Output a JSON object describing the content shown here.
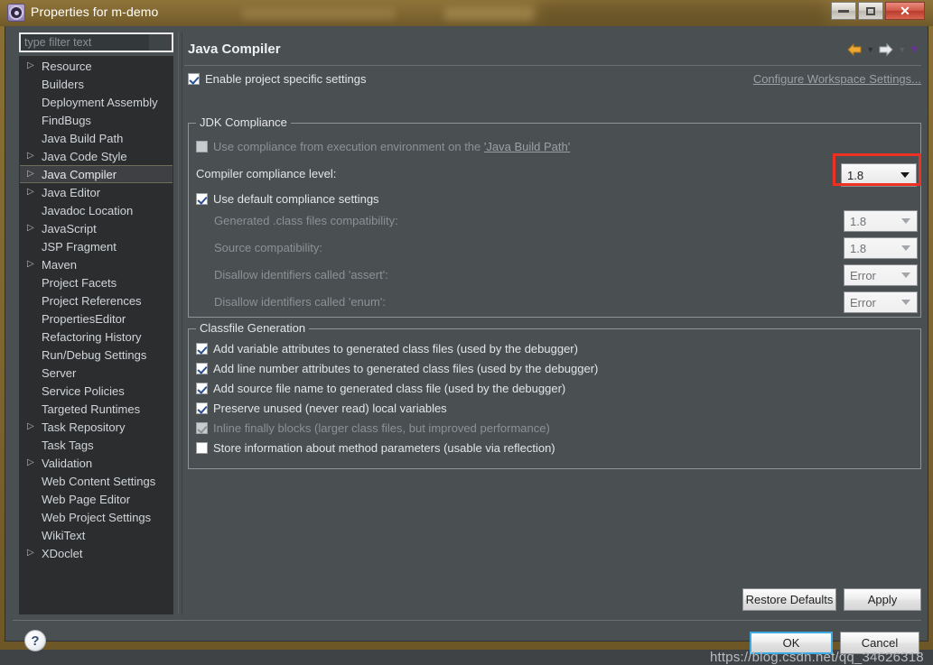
{
  "window": {
    "title": "Properties for m-demo",
    "icon": "gear-icon",
    "buttons": {
      "minimize": "minimize-icon",
      "maximize": "restore-icon",
      "close": "✕"
    }
  },
  "sidebar": {
    "filter": {
      "placeholder": "type filter text",
      "value": ""
    },
    "items": [
      {
        "label": "Resource",
        "expandable": true,
        "selected": false
      },
      {
        "label": "Builders",
        "expandable": false,
        "selected": false
      },
      {
        "label": "Deployment Assembly",
        "expandable": false,
        "selected": false
      },
      {
        "label": "FindBugs",
        "expandable": false,
        "selected": false
      },
      {
        "label": "Java Build Path",
        "expandable": false,
        "selected": false
      },
      {
        "label": "Java Code Style",
        "expandable": true,
        "selected": false
      },
      {
        "label": "Java Compiler",
        "expandable": true,
        "selected": true
      },
      {
        "label": "Java Editor",
        "expandable": true,
        "selected": false
      },
      {
        "label": "Javadoc Location",
        "expandable": false,
        "selected": false
      },
      {
        "label": "JavaScript",
        "expandable": true,
        "selected": false
      },
      {
        "label": "JSP Fragment",
        "expandable": false,
        "selected": false
      },
      {
        "label": "Maven",
        "expandable": true,
        "selected": false
      },
      {
        "label": "Project Facets",
        "expandable": false,
        "selected": false
      },
      {
        "label": "Project References",
        "expandable": false,
        "selected": false
      },
      {
        "label": "PropertiesEditor",
        "expandable": false,
        "selected": false
      },
      {
        "label": "Refactoring History",
        "expandable": false,
        "selected": false
      },
      {
        "label": "Run/Debug Settings",
        "expandable": false,
        "selected": false
      },
      {
        "label": "Server",
        "expandable": false,
        "selected": false
      },
      {
        "label": "Service Policies",
        "expandable": false,
        "selected": false
      },
      {
        "label": "Targeted Runtimes",
        "expandable": false,
        "selected": false
      },
      {
        "label": "Task Repository",
        "expandable": true,
        "selected": false
      },
      {
        "label": "Task Tags",
        "expandable": false,
        "selected": false
      },
      {
        "label": "Validation",
        "expandable": true,
        "selected": false
      },
      {
        "label": "Web Content Settings",
        "expandable": false,
        "selected": false
      },
      {
        "label": "Web Page Editor",
        "expandable": false,
        "selected": false
      },
      {
        "label": "Web Project Settings",
        "expandable": false,
        "selected": false
      },
      {
        "label": "WikiText",
        "expandable": false,
        "selected": false
      },
      {
        "label": "XDoclet",
        "expandable": true,
        "selected": false
      }
    ]
  },
  "main": {
    "page_title": "Java Compiler",
    "nav": {
      "back_icon": "back-arrow-icon",
      "back_menu_icon": "chevron-down-icon",
      "forward_icon": "forward-arrow-icon",
      "forward_menu_icon": "chevron-down-icon",
      "overflow_icon": "chevron-down-icon"
    },
    "enable_project_specific": {
      "label": "Enable project specific settings",
      "checked": true
    },
    "configure_workspace_link": "Configure Workspace Settings...",
    "jdk_compliance": {
      "legend": "JDK Compliance",
      "use_execution_env": {
        "label_prefix": "Use compliance from execution environment on the ",
        "link": "'Java Build Path'",
        "checked": false,
        "enabled": false
      },
      "compliance_level": {
        "label": "Compiler compliance level:",
        "value": "1.8",
        "enabled": true,
        "highlighted": true
      },
      "use_default_compliance": {
        "label": "Use default compliance settings",
        "checked": true
      },
      "rows": [
        {
          "label": "Generated .class files compatibility:",
          "value": "1.8",
          "enabled": false
        },
        {
          "label": "Source compatibility:",
          "value": "1.8",
          "enabled": false
        },
        {
          "label": "Disallow identifiers called 'assert':",
          "value": "Error",
          "enabled": false
        },
        {
          "label": "Disallow identifiers called 'enum':",
          "value": "Error",
          "enabled": false
        }
      ]
    },
    "classfile_generation": {
      "legend": "Classfile Generation",
      "options": [
        {
          "label": "Add variable attributes to generated class files (used by the debugger)",
          "checked": true,
          "enabled": true
        },
        {
          "label": "Add line number attributes to generated class files (used by the debugger)",
          "checked": true,
          "enabled": true
        },
        {
          "label": "Add source file name to generated class file (used by the debugger)",
          "checked": true,
          "enabled": true
        },
        {
          "label": "Preserve unused (never read) local variables",
          "checked": true,
          "enabled": true
        },
        {
          "label": "Inline finally blocks (larger class files, but improved performance)",
          "checked": true,
          "enabled": false
        },
        {
          "label": "Store information about method parameters (usable via reflection)",
          "checked": false,
          "enabled": true
        }
      ]
    },
    "restore_defaults": "Restore Defaults",
    "apply": "Apply"
  },
  "footer": {
    "help_icon": "?",
    "ok": "OK",
    "cancel": "Cancel"
  },
  "watermark": "https://blog.csdn.net/qq_34626318",
  "colors": {
    "accent_red": "#ef3124",
    "dialog_bg": "#4a4f52",
    "tree_bg": "#2b2d2e",
    "titlebar_gold": "#836a33",
    "focus_blue": "#3faae2"
  }
}
